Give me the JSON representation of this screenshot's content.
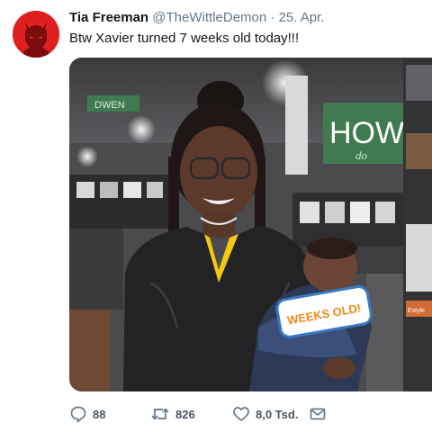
{
  "tweet": {
    "display_name": "Tia Freeman",
    "handle": "@TheWittleDemon",
    "separator": "·",
    "date": "25. Apr.",
    "text": "Btw Xavier turned 7 weeks old today!!!"
  },
  "media": {
    "store_sign": "HOW",
    "store_sign_small": "do",
    "banner_left": "DWEN",
    "baby_sign_text": "WEEKS OLD!",
    "side_tag": "Estyle"
  },
  "actions": {
    "replies": "88",
    "retweets": "826",
    "likes": "8,0 Tsd."
  },
  "icons": {
    "avatar": "devil-avatar-icon",
    "reply": "reply-bubble-icon",
    "retweet": "retweet-arrows-icon",
    "like": "heart-icon",
    "message": "envelope-icon"
  },
  "colors": {
    "avatar_bg": "#e02020",
    "text_primary": "#14171a",
    "text_secondary": "#657786",
    "sign_green": "#3f7a50"
  }
}
